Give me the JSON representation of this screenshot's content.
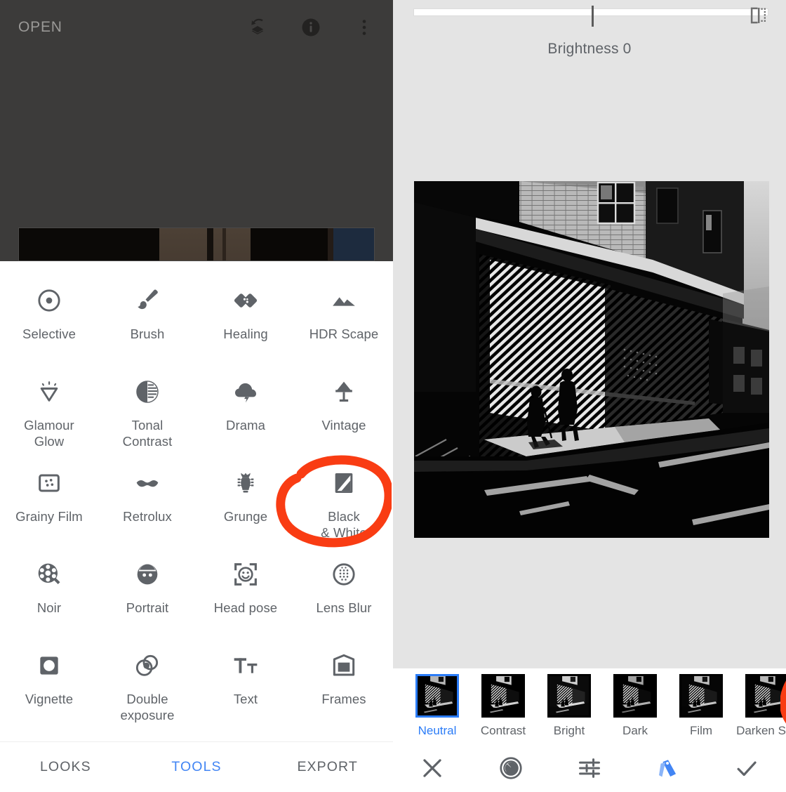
{
  "colors": {
    "accent_blue": "#4285f4",
    "preset_blue": "#2b7cf7",
    "annotation_red": "#f93c13",
    "icon_gray": "#5f6368",
    "left_photo_bg": "#3c3b3a",
    "right_bg": "#e4e4e4"
  },
  "left_panel": {
    "topbar": {
      "open_label": "OPEN",
      "icons": [
        {
          "name": "undo-stack-icon"
        },
        {
          "name": "info-icon"
        },
        {
          "name": "overflow-menu-icon"
        }
      ]
    },
    "tools": [
      {
        "label": "Selective",
        "icon": "selective-icon"
      },
      {
        "label": "Brush",
        "icon": "brush-icon"
      },
      {
        "label": "Healing",
        "icon": "healing-icon"
      },
      {
        "label": "HDR Scape",
        "icon": "hdr-scape-icon"
      },
      {
        "label": "Glamour\nGlow",
        "icon": "glamour-glow-icon"
      },
      {
        "label": "Tonal\nContrast",
        "icon": "tonal-contrast-icon"
      },
      {
        "label": "Drama",
        "icon": "drama-icon"
      },
      {
        "label": "Vintage",
        "icon": "vintage-icon"
      },
      {
        "label": "Grainy Film",
        "icon": "grainy-film-icon"
      },
      {
        "label": "Retrolux",
        "icon": "retrolux-icon"
      },
      {
        "label": "Grunge",
        "icon": "grunge-icon"
      },
      {
        "label": "Black\n& White",
        "icon": "black-and-white-icon"
      },
      {
        "label": "Noir",
        "icon": "noir-icon"
      },
      {
        "label": "Portrait",
        "icon": "portrait-icon"
      },
      {
        "label": "Head pose",
        "icon": "head-pose-icon"
      },
      {
        "label": "Lens Blur",
        "icon": "lens-blur-icon"
      },
      {
        "label": "Vignette",
        "icon": "vignette-icon"
      },
      {
        "label": "Double\nexposure",
        "icon": "double-exposure-icon"
      },
      {
        "label": "Text",
        "icon": "text-icon"
      },
      {
        "label": "Frames",
        "icon": "frames-icon"
      }
    ],
    "bottom_nav": [
      {
        "label": "LOOKS",
        "active": false
      },
      {
        "label": "TOOLS",
        "active": true
      },
      {
        "label": "EXPORT",
        "active": false
      }
    ]
  },
  "right_panel": {
    "parameter": {
      "label": "Brightness 0",
      "name": "Brightness",
      "value": 0,
      "slider_position_percent": 50
    },
    "compare_icon": "compare-icon",
    "presets": [
      {
        "label": "Neutral",
        "selected": true
      },
      {
        "label": "Contrast",
        "selected": false
      },
      {
        "label": "Bright",
        "selected": false
      },
      {
        "label": "Dark",
        "selected": false
      },
      {
        "label": "Film",
        "selected": false
      },
      {
        "label": "Darken Sky",
        "selected": false
      }
    ],
    "toolbar": [
      {
        "name": "cancel-icon",
        "active": false
      },
      {
        "name": "grain-icon",
        "active": false
      },
      {
        "name": "tune-icon",
        "active": false
      },
      {
        "name": "presets-icon",
        "active": true
      },
      {
        "name": "apply-icon",
        "active": false
      }
    ]
  },
  "annotations": [
    {
      "name": "annotation-circle-black-and-white",
      "target": "Black & White"
    },
    {
      "name": "annotation-circle-neutral-preset",
      "target": "Neutral"
    }
  ]
}
